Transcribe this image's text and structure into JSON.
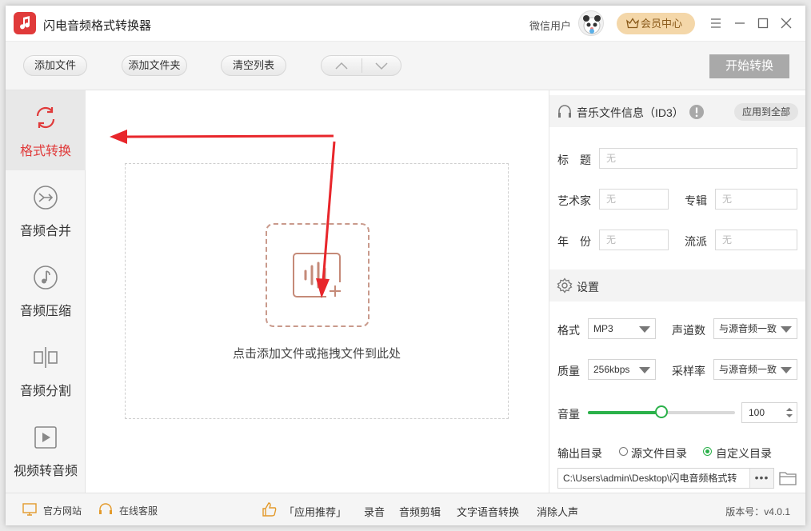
{
  "app": {
    "title": "闪电音频格式转换器",
    "user": "微信用户",
    "vip_label": "会员中心"
  },
  "toolbar": {
    "add_file": "添加文件",
    "add_folder": "添加文件夹",
    "clear_list": "清空列表",
    "start": "开始转换"
  },
  "nav": [
    {
      "label": "格式转换",
      "icon": "refresh-icon",
      "active": true
    },
    {
      "label": "音频合并",
      "icon": "merge-icon"
    },
    {
      "label": "音频压缩",
      "icon": "music-note-icon"
    },
    {
      "label": "音频分割",
      "icon": "split-icon"
    },
    {
      "label": "视频转音频",
      "icon": "video-play-icon"
    }
  ],
  "drop": {
    "text": "点击添加文件或拖拽文件到此处"
  },
  "id3": {
    "header": "音乐文件信息（ID3）",
    "apply_all": "应用到全部",
    "title_label": "标　题",
    "title_value": "无",
    "artist_label": "艺术家",
    "artist_value": "无",
    "album_label": "专辑",
    "album_value": "无",
    "year_label": "年　份",
    "year_value": "无",
    "genre_label": "流派",
    "genre_value": "无"
  },
  "settings": {
    "header": "设置",
    "format_label": "格式",
    "format_value": "MP3",
    "channels_label": "声道数",
    "channels_value": "与源音频一致",
    "quality_label": "质量",
    "quality_value": "256kbps",
    "samplerate_label": "采样率",
    "samplerate_value": "与源音频一致",
    "volume_label": "音量",
    "volume_value": "100",
    "volume_fraction": 0.5,
    "output_label": "输出目录",
    "output_source": "源文件目录",
    "output_custom": "自定义目录",
    "output_selected": "custom",
    "output_path": "C:\\Users\\admin\\Desktop\\闪电音频格式转"
  },
  "footer": {
    "website": "官方网站",
    "support": "在线客服",
    "recommend": "「应用推荐」",
    "record": "录音",
    "edit": "音频剪辑",
    "tts": "文字语音转换",
    "vocal": "消除人声",
    "version": "版本号：v4.0.1"
  },
  "colors": {
    "accent": "#e03a3a",
    "green": "#2bb14a",
    "start_btn": "#a9a9a9"
  }
}
